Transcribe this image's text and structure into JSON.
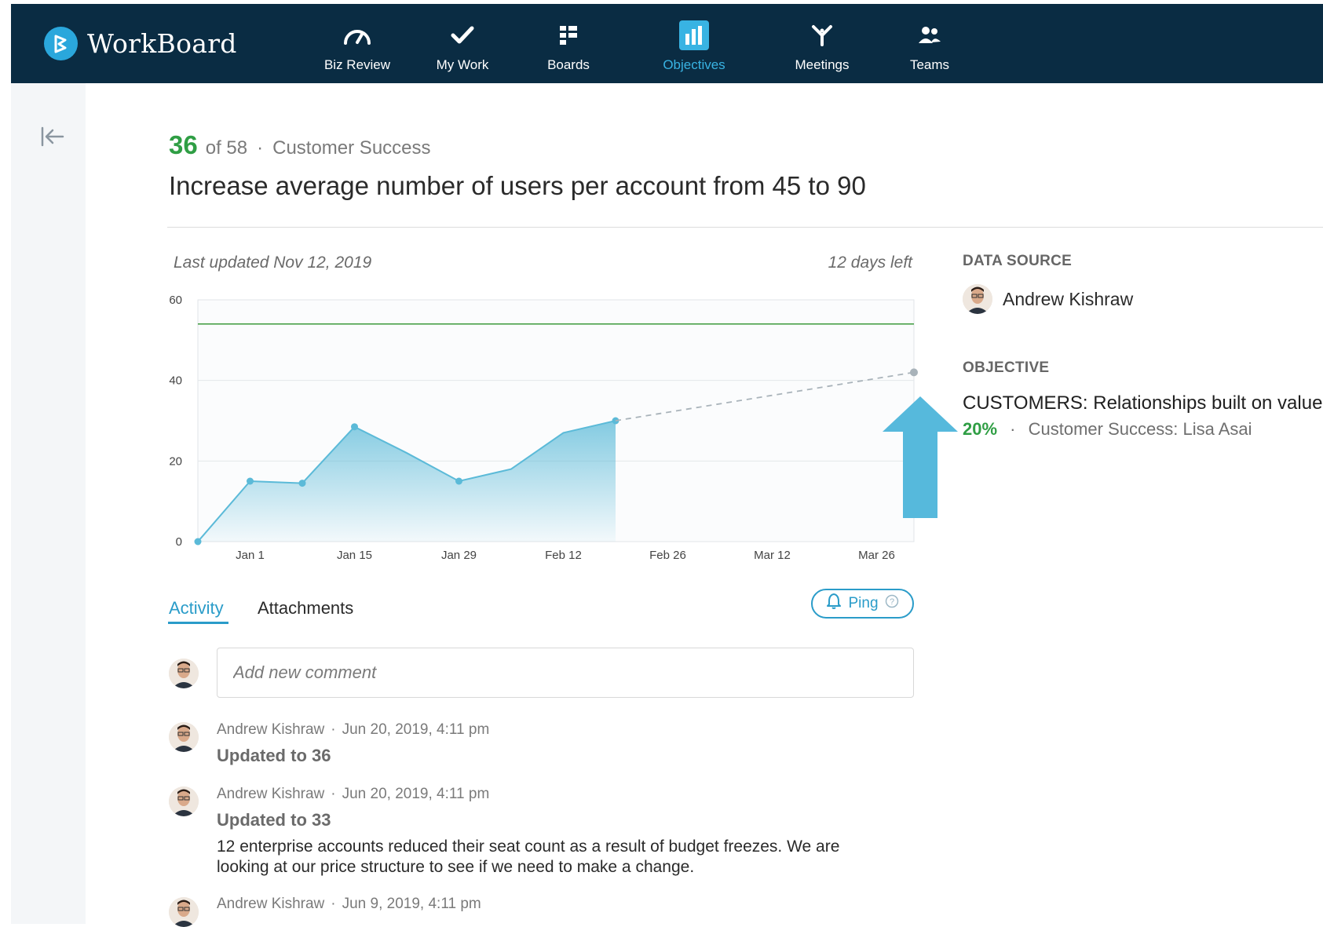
{
  "app": {
    "name": "WorkBoard"
  },
  "nav": {
    "items": [
      {
        "label": "Biz Review",
        "icon": "speedometer-icon"
      },
      {
        "label": "My Work",
        "icon": "checkmark-icon"
      },
      {
        "label": "Boards",
        "icon": "boards-grid-icon"
      },
      {
        "label": "Objectives",
        "icon": "bar-chart-icon",
        "active": true
      },
      {
        "label": "Meetings",
        "icon": "meetings-icon"
      },
      {
        "label": "Teams",
        "icon": "teams-icon"
      }
    ],
    "active_color": "#38b3e3",
    "background": "#0a2c43"
  },
  "header": {
    "current": "36",
    "of_total": "of 58",
    "separator": "·",
    "team": "Customer Success",
    "title": "Increase average number of users per account from 45 to 90"
  },
  "chart_meta": {
    "last_updated": "Last updated Nov 12, 2019",
    "days_left": "12 days left"
  },
  "chart_data": {
    "type": "area",
    "x_tick_labels": [
      "Jan 1",
      "Jan 15",
      "Jan 29",
      "Feb 12",
      "Feb 26",
      "Mar 12",
      "Mar 26"
    ],
    "y_tick_labels": [
      "0",
      "20",
      "40",
      "60"
    ],
    "ylim": [
      0,
      60
    ],
    "target_line": 54,
    "series": [
      {
        "style": "actual",
        "x": [
          "Dec 25",
          "Jan 1",
          "Jan 8",
          "Jan 15",
          "Jan 22",
          "Jan 29",
          "Feb 5",
          "Feb 12",
          "Feb 19"
        ],
        "y": [
          0,
          15,
          14.5,
          28.5,
          22,
          15,
          18,
          27,
          30
        ],
        "markers": [
          true,
          true,
          true,
          true,
          false,
          true,
          false,
          false,
          true
        ]
      },
      {
        "style": "projected",
        "x": [
          "Feb 19",
          "Mar 31"
        ],
        "y": [
          30,
          42
        ]
      }
    ],
    "colors": {
      "actual": "#5bbad8",
      "target": "#3c9a3c",
      "projection": "#a9b3ba"
    }
  },
  "side": {
    "data_source_heading": "DATA SOURCE",
    "data_source_name": "Andrew Kishraw",
    "objective_heading": "OBJECTIVE",
    "objective_name": "CUSTOMERS: Relationships built on value",
    "objective_pct": "20%",
    "objective_separator": "·",
    "objective_owner": "Customer Success: Lisa Asai"
  },
  "tabs": {
    "activity": "Activity",
    "attachments": "Attachments"
  },
  "ping": {
    "label": "Ping"
  },
  "comment": {
    "placeholder": "Add new comment"
  },
  "activity": [
    {
      "author": "Andrew Kishraw",
      "separator": "·",
      "time": "Jun 20, 2019, 4:11 pm",
      "update": "Updated to 36",
      "note": ""
    },
    {
      "author": "Andrew Kishraw",
      "separator": "·",
      "time": "Jun 20, 2019, 4:11 pm",
      "update": "Updated to 33",
      "note": "12 enterprise accounts reduced their seat count as a result of budget freezes. We are looking at our price structure to see if we need to make a change."
    },
    {
      "author": "Andrew Kishraw",
      "separator": "·",
      "time": "Jun 9, 2019, 4:11 pm",
      "update": "",
      "note": ""
    }
  ]
}
